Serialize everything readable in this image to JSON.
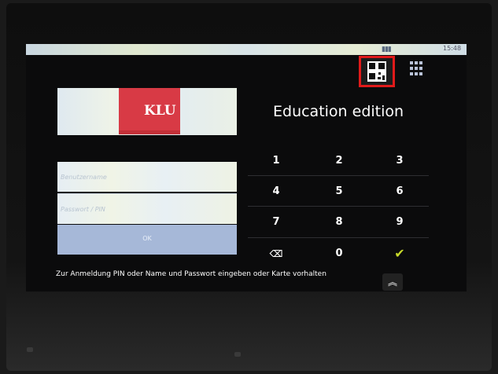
{
  "status_bar": {
    "time": "15:48"
  },
  "logo": {
    "text": "KLU"
  },
  "login": {
    "username_placeholder": "Benutzername",
    "password_placeholder": "Passwort / PIN",
    "ok_label": "OK",
    "hint": "Zur Anmeldung PIN oder Name und Passwort eingeben oder Karte vorhalten"
  },
  "title": "Education edition",
  "keypad": {
    "keys": [
      "1",
      "2",
      "3",
      "4",
      "5",
      "6",
      "7",
      "8",
      "9",
      "⌫",
      "0",
      "✔"
    ]
  },
  "icons": {
    "qr": "qr-code-icon",
    "grid": "grid-menu-icon",
    "chevron": "double-chevron-up-icon"
  }
}
